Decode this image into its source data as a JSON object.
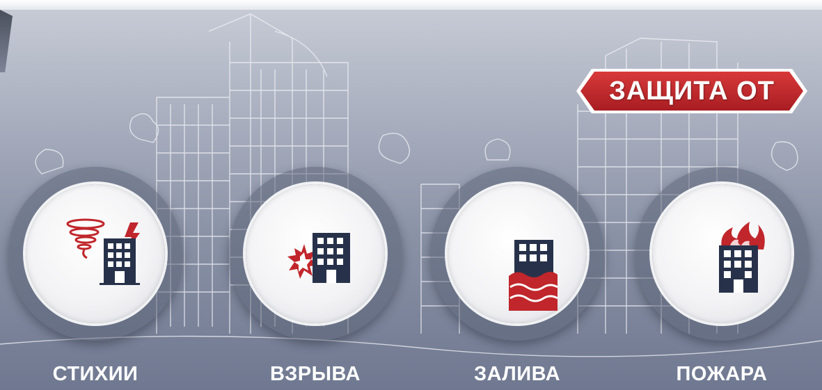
{
  "badge": {
    "text": "ЗАЩИТА ОТ"
  },
  "items": [
    {
      "label": "СТИХИИ",
      "icon": "tornado-lightning-building-icon"
    },
    {
      "label": "ВЗРЫВА",
      "icon": "explosion-building-icon"
    },
    {
      "label": "ЗАЛИВА",
      "icon": "flood-building-icon"
    },
    {
      "label": "ПОЖАРА",
      "icon": "fire-building-icon"
    }
  ],
  "colors": {
    "accent_red": "#c0262b",
    "building_navy": "#27324a",
    "label_white": "#ffffff"
  }
}
